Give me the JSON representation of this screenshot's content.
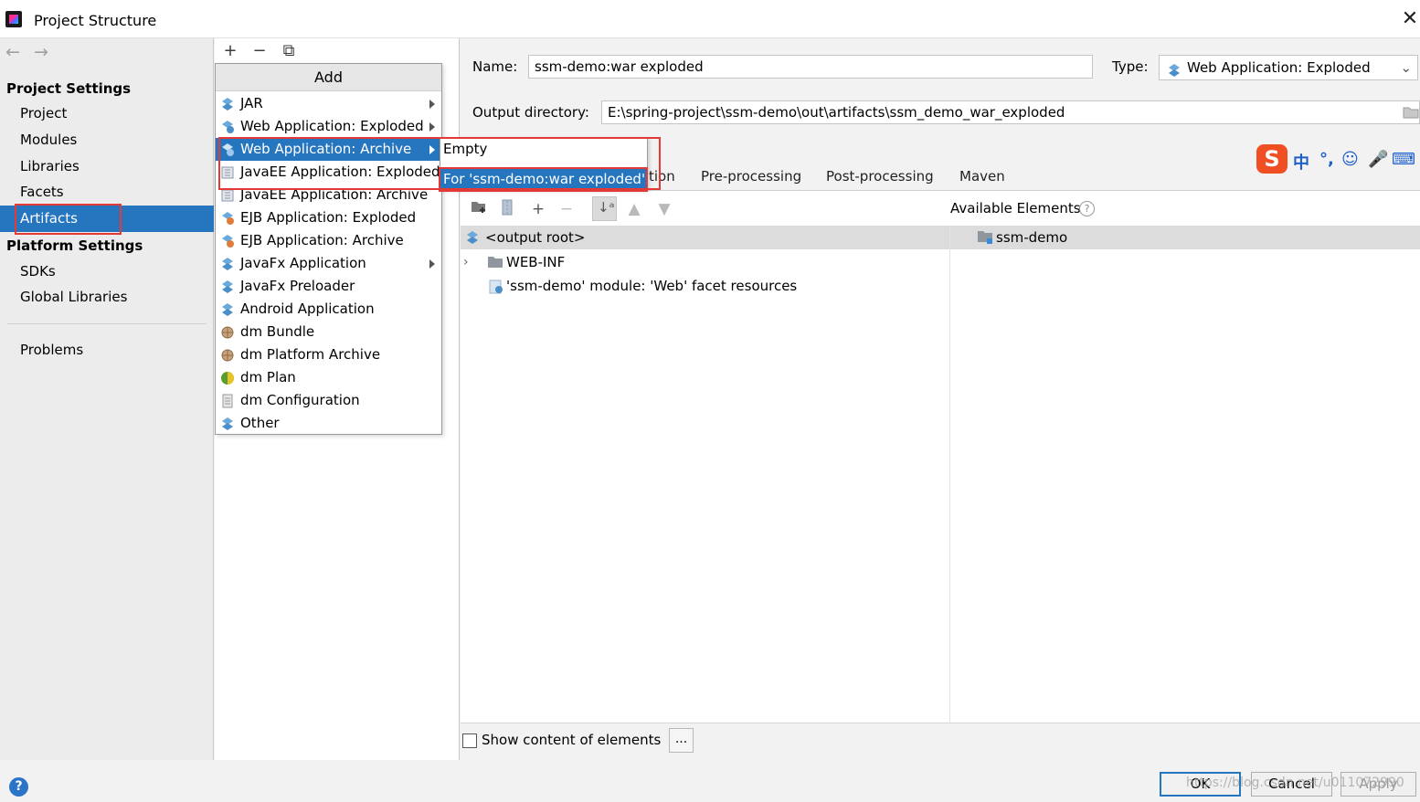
{
  "window": {
    "title": "Project Structure",
    "close_glyph": "✕"
  },
  "nav": {
    "back_glyph": "←",
    "forward_glyph": "→",
    "project_settings_header": "Project Settings",
    "project_settings_items": [
      "Project",
      "Modules",
      "Libraries",
      "Facets",
      "Artifacts"
    ],
    "selected_item": "Artifacts",
    "platform_settings_header": "Platform Settings",
    "platform_settings_items": [
      "SDKs",
      "Global Libraries"
    ],
    "problems": "Problems"
  },
  "artifacts_toolbar": {
    "add_glyph": "+",
    "remove_glyph": "−",
    "copy_glyph": "⧉"
  },
  "add_popup": {
    "header": "Add",
    "items": [
      {
        "label": "JAR",
        "icon": "jar-icon",
        "submenu": true
      },
      {
        "label": "Web Application: Exploded",
        "icon": "web-exploded-icon",
        "submenu": true
      },
      {
        "label": "Web Application: Archive",
        "icon": "web-archive-icon",
        "submenu": true,
        "selected": true
      },
      {
        "label": "JavaEE Application: Exploded",
        "icon": "javaee-exploded-icon",
        "submenu": false
      },
      {
        "label": "JavaEE Application: Archive",
        "icon": "javaee-archive-icon",
        "submenu": false
      },
      {
        "label": "EJB Application: Exploded",
        "icon": "ejb-exploded-icon",
        "submenu": false
      },
      {
        "label": "EJB Application: Archive",
        "icon": "ejb-archive-icon",
        "submenu": false
      },
      {
        "label": "JavaFx Application",
        "icon": "javafx-app-icon",
        "submenu": true
      },
      {
        "label": "JavaFx Preloader",
        "icon": "javafx-preloader-icon",
        "submenu": false
      },
      {
        "label": "Android Application",
        "icon": "android-app-icon",
        "submenu": false
      },
      {
        "label": "dm Bundle",
        "icon": "dm-bundle-icon",
        "submenu": false
      },
      {
        "label": "dm Platform Archive",
        "icon": "dm-platform-archive-icon",
        "submenu": false
      },
      {
        "label": "dm Plan",
        "icon": "dm-plan-icon",
        "submenu": false
      },
      {
        "label": "dm Configuration",
        "icon": "dm-configuration-icon",
        "submenu": false
      },
      {
        "label": "Other",
        "icon": "other-icon",
        "submenu": false
      }
    ]
  },
  "submenu": {
    "items": [
      "Empty",
      "For 'ssm-demo:war exploded'"
    ],
    "selected_index": 1
  },
  "artifact_form": {
    "name_label": "Name:",
    "name_value": "ssm-demo:war exploded",
    "type_label": "Type:",
    "type_value": "Web Application: Exploded",
    "output_dir_label": "Output directory:",
    "output_dir_value": "E:\\spring-project\\ssm-demo\\out\\artifacts\\ssm_demo_war_exploded"
  },
  "tabs": {
    "partial_tab_fragment": "tion",
    "items": [
      "Pre-processing",
      "Post-processing",
      "Maven"
    ]
  },
  "layout_tree": {
    "rows": [
      {
        "label": "<output root>",
        "icon": "output-root-icon"
      },
      {
        "label": "WEB-INF",
        "icon": "folder-icon",
        "expandable": true
      },
      {
        "label": "'ssm-demo' module: 'Web' facet resources",
        "icon": "web-facet-resource-icon"
      }
    ]
  },
  "available": {
    "header": "Available Elements",
    "help_glyph": "?",
    "items": [
      "ssm-demo"
    ]
  },
  "bottom": {
    "show_content_label": "Show content of elements",
    "show_content_checked": false,
    "more_button": "..."
  },
  "footer": {
    "help_glyph": "?",
    "ok": "OK",
    "cancel": "Cancel",
    "apply": "Apply",
    "watermark": "https://blog.csdn.net/u011072990"
  },
  "ime": {
    "logo": "S",
    "glyphs": [
      "中",
      "°,",
      "☺",
      "🎤",
      "⌨"
    ]
  },
  "colors": {
    "selection": "#2675bf",
    "highlight_box": "#e53935",
    "ime_brand": "#f04e23"
  }
}
